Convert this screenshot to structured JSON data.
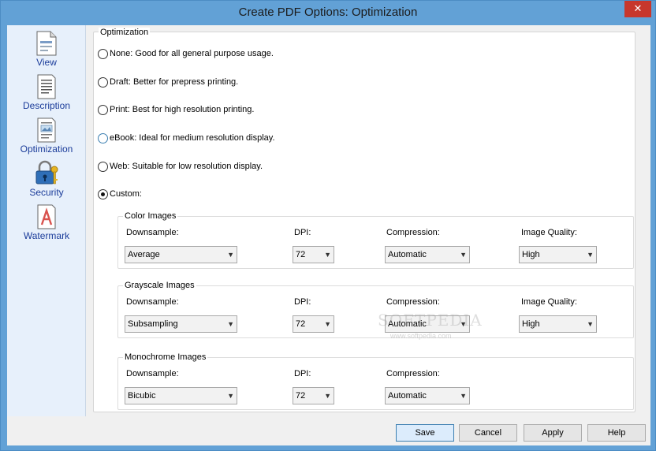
{
  "window": {
    "title": "Create PDF Options: Optimization",
    "close_glyph": "✕"
  },
  "sidebar": {
    "items": [
      {
        "label": "View",
        "icon": "document-view-icon"
      },
      {
        "label": "Description",
        "icon": "document-text-icon"
      },
      {
        "label": "Optimization",
        "icon": "document-image-icon"
      },
      {
        "label": "Security",
        "icon": "lock-keys-icon"
      },
      {
        "label": "Watermark",
        "icon": "watermark-document-icon"
      }
    ]
  },
  "optimization": {
    "legend": "Optimization",
    "options": [
      {
        "label": "None: Good for all general purpose usage.",
        "checked": false
      },
      {
        "label": "Draft: Better for prepress printing.",
        "checked": false
      },
      {
        "label": "Print: Best for high resolution printing.",
        "checked": false
      },
      {
        "label": "eBook: Ideal for medium resolution display.",
        "checked": false
      },
      {
        "label": "Web: Suitable for low resolution display.",
        "checked": false
      },
      {
        "label": "Custom:",
        "checked": true
      }
    ]
  },
  "groups": {
    "color": {
      "legend": "Color Images",
      "downsample_label": "Downsample:",
      "downsample_value": "Average",
      "dpi_label": "DPI:",
      "dpi_value": "72",
      "compression_label": "Compression:",
      "compression_value": "Automatic",
      "quality_label": "Image Quality:",
      "quality_value": "High"
    },
    "grayscale": {
      "legend": "Grayscale Images",
      "downsample_label": "Downsample:",
      "downsample_value": "Subsampling",
      "dpi_label": "DPI:",
      "dpi_value": "72",
      "compression_label": "Compression:",
      "compression_value": "Automatic",
      "quality_label": "Image Quality:",
      "quality_value": "High"
    },
    "monochrome": {
      "legend": "Monochrome Images",
      "downsample_label": "Downsample:",
      "downsample_value": "Bicubic",
      "dpi_label": "DPI:",
      "dpi_value": "72",
      "compression_label": "Compression:",
      "compression_value": "Automatic"
    }
  },
  "buttons": {
    "save": "Save",
    "cancel": "Cancel",
    "apply": "Apply",
    "help": "Help"
  },
  "watermark": {
    "text": "SOFTPEDIA",
    "url": "www.softpedia.com"
  },
  "colors": {
    "title_bar": "#62a1d6",
    "close_button": "#c7372c",
    "sidebar_bg": "#e7f0fb",
    "nav_label": "#1b3c9a"
  }
}
